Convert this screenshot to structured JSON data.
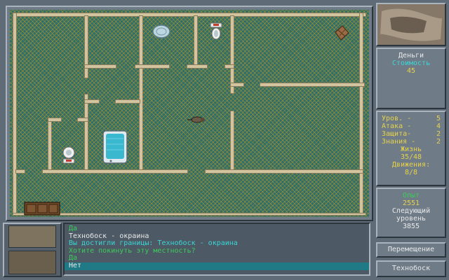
{
  "right_panel": {
    "money_label": "Деньги",
    "value_label": "Стоимость",
    "value": "45",
    "stats": [
      {
        "label": "Уров. -",
        "value": "5"
      },
      {
        "label": "Атака -",
        "value": "4"
      },
      {
        "label": "Защита-",
        "value": "2"
      },
      {
        "label": "Знания -",
        "value": "2"
      }
    ],
    "life_label": "Жизнь",
    "life_value": "35/48",
    "moves_label": "Движения:",
    "moves_value": "8/8",
    "exp_label": "Опыт",
    "exp_value": "2551",
    "next_level_label_1": "Следующий",
    "next_level_label_2": "уровень",
    "next_level_value": "3855",
    "move_button": "Перемещение",
    "location_button": "Технобоск"
  },
  "log": {
    "lines": [
      {
        "text": "Да",
        "color": "#3ccc5c"
      },
      {
        "text": "Технобоск - окраина",
        "color": "#e8e8e8"
      },
      {
        "text": "Вы достигли границы: Технобоск - окраина",
        "color": "#3ad6d6"
      },
      {
        "text": "Хотите покинуть эту местность?",
        "color": "#3ccc5c"
      },
      {
        "text": "Да",
        "color": "#3ccc5c"
      },
      {
        "text": "Нет",
        "color": "#e8e8e8"
      }
    ],
    "selected_index": 5,
    "highlight_color": "#1f7a86"
  },
  "colors": {
    "floor": "#2e6e6a",
    "wall": "#d2c49e",
    "panel": "#6f7c88"
  },
  "icons": [
    "map-thumbnail",
    "table-icon",
    "toilet-icon",
    "sink-icon",
    "bathtub-icon",
    "crate-icon",
    "rat-enemy-icon",
    "cabinet-icon"
  ]
}
